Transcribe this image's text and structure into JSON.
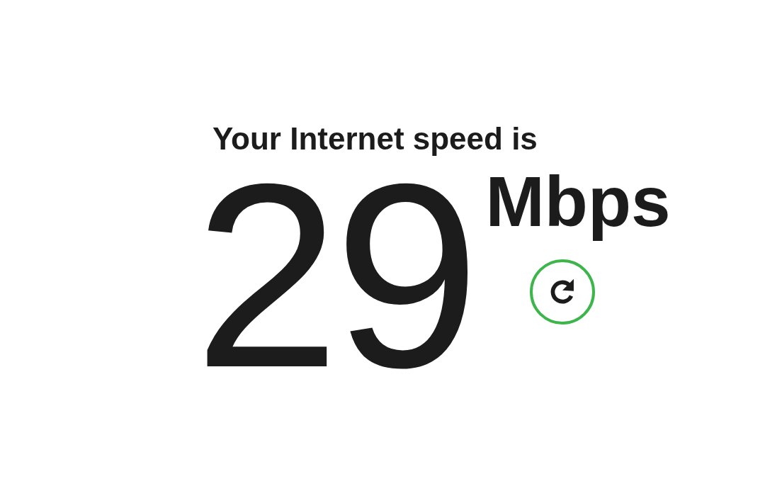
{
  "heading": "Your Internet speed is",
  "speed": {
    "value": "29",
    "unit": "Mbps"
  }
}
